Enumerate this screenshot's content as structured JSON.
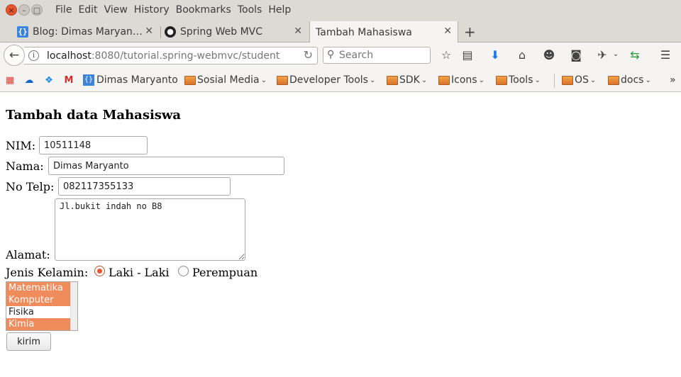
{
  "menu": [
    "File",
    "Edit",
    "View",
    "History",
    "Bookmarks",
    "Tools",
    "Help"
  ],
  "tabs": [
    {
      "label": "Blog: Dimas Maryan…",
      "icon": "braces-icon"
    },
    {
      "label": "Spring Web MVC",
      "icon": "github-icon"
    },
    {
      "label": "Tambah Mahasiswa",
      "icon": ""
    }
  ],
  "url": {
    "host": "localhost",
    "rest": ":8080/tutorial.spring-webmvc/student"
  },
  "search": {
    "placeholder": "Search"
  },
  "bookmarks": [
    {
      "label": "Dimas Maryanto",
      "type": "site"
    },
    {
      "label": "Sosial Media",
      "type": "folder"
    },
    {
      "label": "Developer Tools",
      "type": "folder"
    },
    {
      "label": "SDK",
      "type": "folder"
    },
    {
      "label": "Icons",
      "type": "folder"
    },
    {
      "label": "Tools",
      "type": "folder"
    },
    {
      "label": "OS",
      "type": "folder"
    },
    {
      "label": "docs",
      "type": "folder"
    }
  ],
  "page": {
    "heading": "Tambah data Mahasiswa",
    "nim_label": "NIM:",
    "nim_value": "10511148",
    "nama_label": "Nama:",
    "nama_value": "Dimas Maryanto",
    "telp_label": "No Telp:",
    "telp_value": "082117355133",
    "alamat_label": "Alamat:",
    "alamat_value": "Jl.bukit indah no B8",
    "gender_label": "Jenis Kelamin:",
    "gender_options": [
      {
        "label": "Laki - Laki",
        "checked": true
      },
      {
        "label": "Perempuan",
        "checked": false
      }
    ],
    "subjects": [
      {
        "label": "Matematika",
        "selected": true
      },
      {
        "label": "Komputer",
        "selected": true
      },
      {
        "label": "Fisika",
        "selected": false
      },
      {
        "label": "Kimia",
        "selected": true
      }
    ],
    "submit_label": "kirim"
  },
  "colors": {
    "selection": "#f08b5c",
    "radio_checked": "#e5572b",
    "chrome": "#dcdad5"
  }
}
